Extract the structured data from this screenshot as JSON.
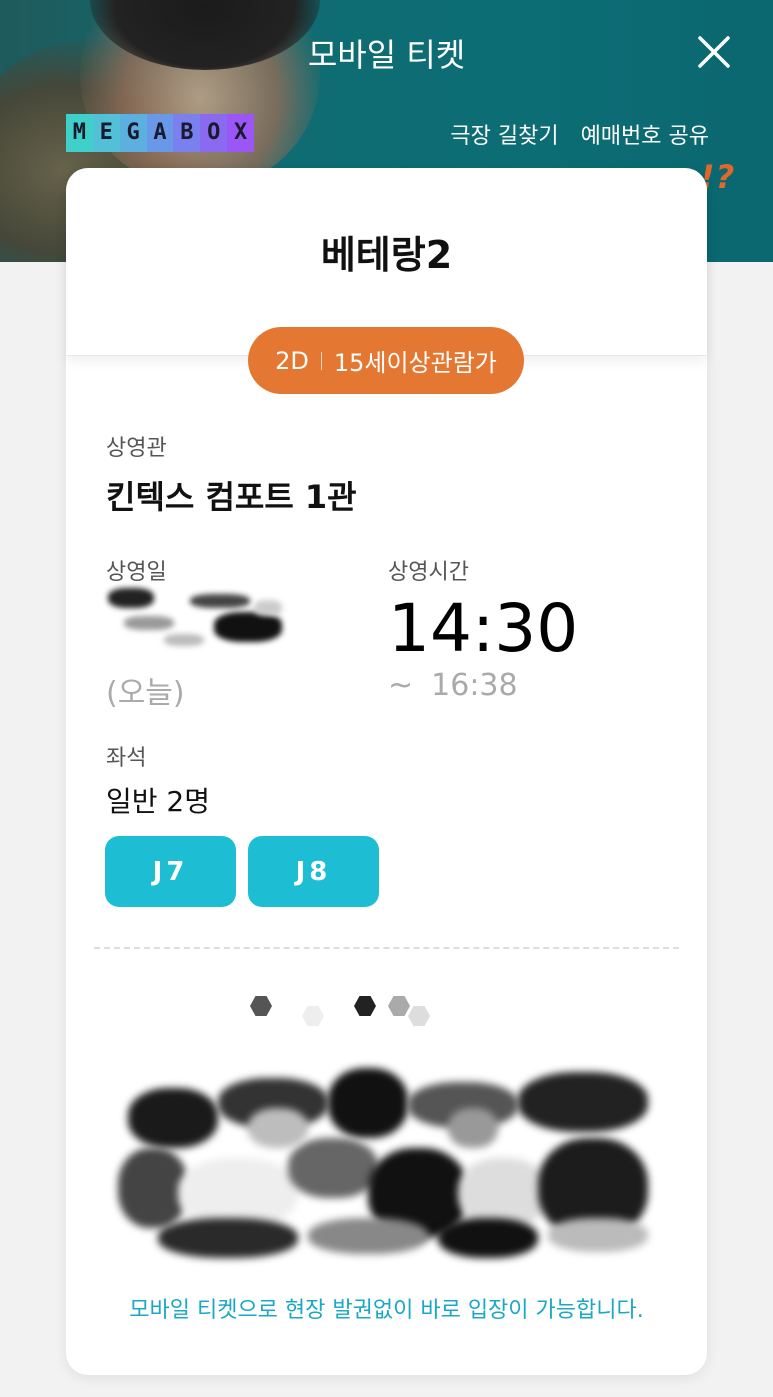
{
  "header": {
    "title": "모바일 티켓",
    "close_icon": "close-icon",
    "logo_letters": [
      "M",
      "E",
      "G",
      "A",
      "B",
      "O",
      "X"
    ],
    "logo_colors": [
      "#3fd1c9",
      "#52c1d8",
      "#5bb0e0",
      "#6a98e8",
      "#7a80ee",
      "#8b6af2",
      "#9a57f6"
    ],
    "links": [
      "극장 길찾기",
      "예매번호 공유"
    ],
    "poster_text": "!?"
  },
  "ticket": {
    "movie_title": "베테랑2",
    "format": "2D",
    "rating": "15세이상관람가",
    "theater_label": "상영관",
    "theater_value": "킨텍스 컴포트 1관",
    "date_label": "상영일",
    "date_today": "(오늘)",
    "time_label": "상영시간",
    "start_time": "14:30",
    "end_tilde": "~",
    "end_time": "16:38",
    "seat_label": "좌석",
    "seat_count": "일반 2명",
    "seats": [
      "J7",
      "J8"
    ],
    "notice": "모바일 티켓으로 현장 발권없이 바로 입장이 가능합니다."
  },
  "colors": {
    "accent_orange": "#e47731",
    "seat_cyan": "#1dbdd3",
    "notice_cyan": "#1aa8c5",
    "hero_teal": "#0c6d75"
  }
}
